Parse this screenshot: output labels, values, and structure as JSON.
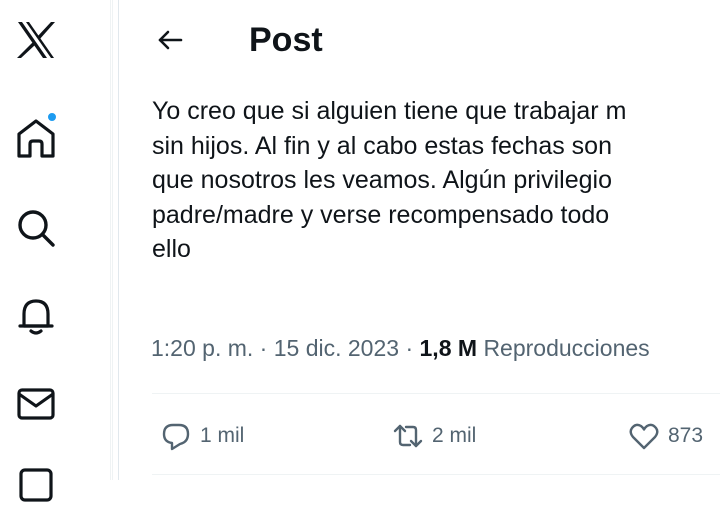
{
  "header": {
    "title": "Post",
    "back_label": "←"
  },
  "tweet": {
    "lines": [
      "Yo creo que si alguien tiene que trabajar m",
      "sin hijos. Al fin y al cabo estas fechas son",
      "que nosotros les veamos. Algún privilegio",
      "padre/madre y verse recompensado todo",
      "ello"
    ],
    "time": "1:20 p. m.",
    "separator": "·",
    "date": "15 dic. 2023",
    "views_count": "1,8 M",
    "views_label": "Reproducciones"
  },
  "actions": {
    "replies": "1 mil",
    "reposts": "2 mil",
    "likes": "873"
  },
  "colors": {
    "accent": "#1d9bf0",
    "text": "#0f1419",
    "muted": "#536471",
    "border": "#eff3f4"
  },
  "icons": [
    "x-logo-icon",
    "home-icon",
    "search-icon",
    "bell-icon",
    "mail-icon",
    "arrow-left-icon",
    "reply-icon",
    "repost-icon",
    "like-icon"
  ]
}
